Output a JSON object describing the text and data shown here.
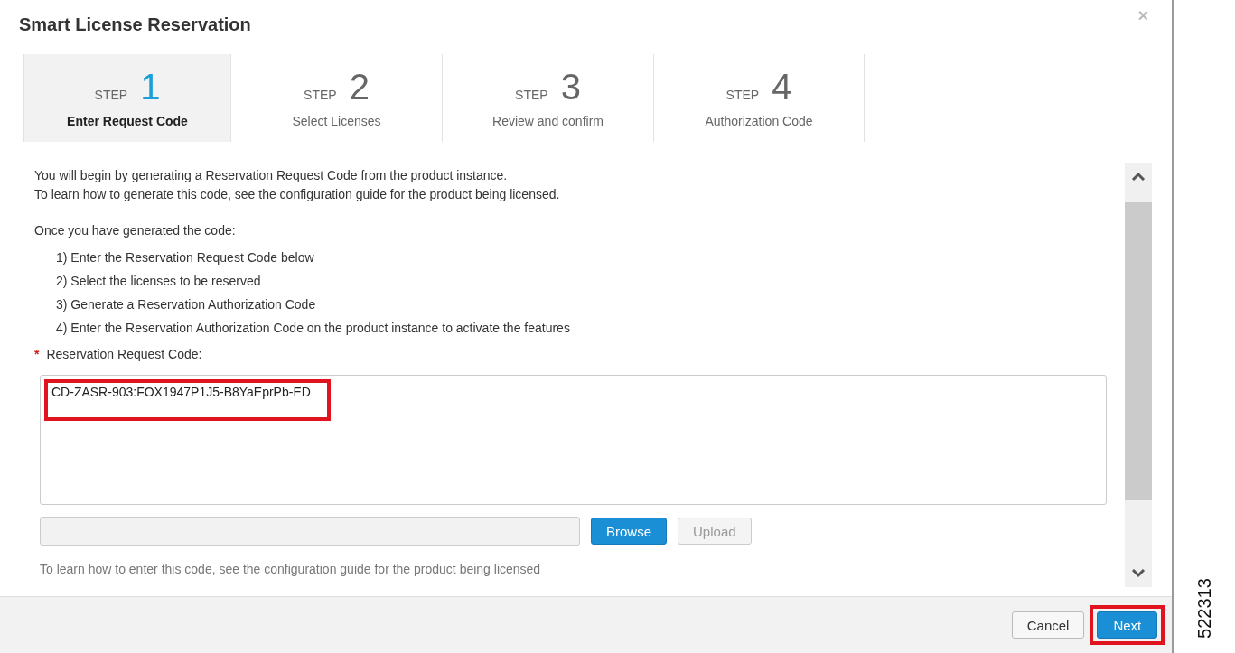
{
  "dialog": {
    "title": "Smart License Reservation",
    "close": "×"
  },
  "steps": [
    {
      "prefix": "STEP",
      "number": "1",
      "label": "Enter Request Code",
      "selected": true
    },
    {
      "prefix": "STEP",
      "number": "2",
      "label": "Select Licenses",
      "selected": false
    },
    {
      "prefix": "STEP",
      "number": "3",
      "label": "Review and confirm",
      "selected": false
    },
    {
      "prefix": "STEP",
      "number": "4",
      "label": "Authorization Code",
      "selected": false
    }
  ],
  "intro": [
    "You will begin by generating a Reservation Request Code from the product instance.",
    "To learn how to generate this code, see the configuration guide for the product being licensed."
  ],
  "once_heading": "Once you have generated the code:",
  "instructions": [
    "1) Enter the Reservation Request Code below",
    "2) Select the licenses to be reserved",
    "3) Generate a Reservation Authorization Code",
    "4) Enter the Reservation Authorization Code on the product instance to activate the features"
  ],
  "field": {
    "required_mark": "*",
    "label": "Reservation Request Code:",
    "value": "CD-ZASR-903:FOX1947P1J5-B8YaEprPb-ED",
    "highlighted": true
  },
  "file": {
    "browse": "Browse",
    "upload": "Upload",
    "upload_disabled": true
  },
  "help": "To learn how to enter this code, see the configuration guide for the product being licensed",
  "footer": {
    "cancel": "Cancel",
    "next": "Next",
    "next_highlighted": true
  },
  "figure_number": "522313"
}
